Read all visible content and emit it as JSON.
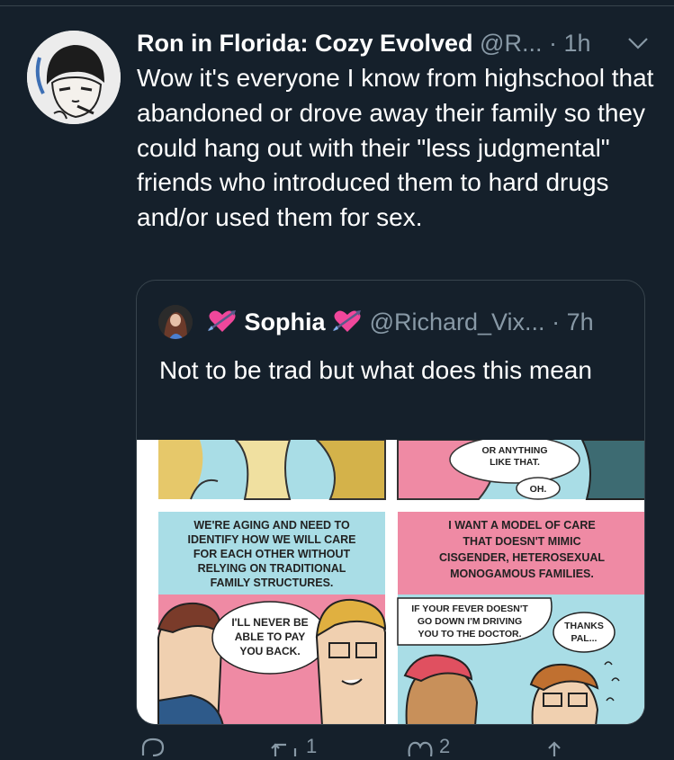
{
  "tweet": {
    "author_name": "Ron in Florida: Cozy Evolved",
    "handle": "@R...",
    "separator": "·",
    "time": "1h",
    "text": "Wow it's everyone I know from highschool that abandoned or drove away their family so they could hang out with their \"less judgmental\" friends who introduced them to hard drugs and/or used them for sex."
  },
  "quoted": {
    "author_name": "Sophia",
    "handle": "@Richard_Vix...",
    "separator": "·",
    "time": "7h",
    "text": "Not to be trad but what does this mean",
    "comic": {
      "p2_line1": "OR ANYTHING",
      "p2_line2": "LIKE THAT.",
      "p2_oh": "OH.",
      "p3_caption": [
        "WE'RE AGING AND NEED TO",
        "IDENTIFY HOW WE WILL CARE",
        "FOR EACH OTHER WITHOUT",
        "RELYING ON TRADITIONAL",
        "FAMILY STRUCTURES."
      ],
      "p3_bubble": [
        "I'LL NEVER BE",
        "ABLE TO PAY",
        "YOU BACK."
      ],
      "p4_caption": [
        "I WANT A MODEL OF CARE",
        "THAT DOESN'T MIMIC",
        "CISGENDER, HETEROSEXUAL",
        "MONOGAMOUS FAMILIES."
      ],
      "p4_bubble": [
        "IF YOUR FEVER DOESN'T",
        "GO DOWN I'M DRIVING",
        "YOU TO THE DOCTOR."
      ],
      "p4_bubble2": [
        "THANKS",
        "PAL..."
      ]
    }
  },
  "actions": {
    "retweets": "1",
    "likes": "2"
  },
  "icons": {
    "chevron": "chevron-down-icon",
    "reply": "reply-icon",
    "retweet": "retweet-icon",
    "like": "heart-icon",
    "share": "share-icon",
    "emoji": "heart-with-arrow-emoji"
  },
  "colors": {
    "background": "#15202b",
    "secondary_text": "#8899a6",
    "border": "#38444d",
    "comic_pink": "#ef8aa4",
    "comic_blue": "#a9dde6"
  }
}
